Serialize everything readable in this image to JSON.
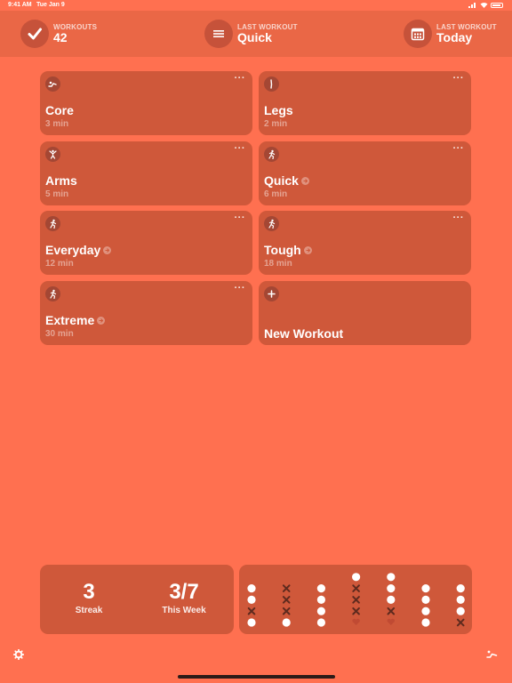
{
  "status_bar": {
    "time": "9:41 AM",
    "date": "Tue Jan 9"
  },
  "header": {
    "workouts": {
      "label": "WORKOUTS",
      "value": "42",
      "icon": "checkmark-icon"
    },
    "last_workout": {
      "label": "LAST WORKOUT",
      "value": "Quick",
      "icon": "list-icon"
    },
    "last_date": {
      "label": "LAST WORKOUT",
      "value": "Today",
      "icon": "calendar-icon"
    }
  },
  "workouts": [
    {
      "name": "Core",
      "duration": "3 min",
      "icon": "situp-icon",
      "pro": false
    },
    {
      "name": "Legs",
      "duration": "2 min",
      "icon": "legs-icon",
      "pro": false
    },
    {
      "name": "Arms",
      "duration": "5 min",
      "icon": "arms-icon",
      "pro": false
    },
    {
      "name": "Quick",
      "duration": "6 min",
      "icon": "runner-icon",
      "pro": true
    },
    {
      "name": "Everyday",
      "duration": "12 min",
      "icon": "runner-icon",
      "pro": true
    },
    {
      "name": "Tough",
      "duration": "18 min",
      "icon": "runner-icon",
      "pro": true
    },
    {
      "name": "Extreme",
      "duration": "30 min",
      "icon": "runner-icon",
      "pro": true
    }
  ],
  "more_label": "···",
  "new_workout": {
    "label": "New Workout",
    "icon": "plus-icon"
  },
  "streak": {
    "value": "3",
    "label": "Streak"
  },
  "this_week": {
    "value": "3/7",
    "label": "This Week"
  },
  "week_columns": [
    [
      "dot",
      "dot",
      "x",
      "dot"
    ],
    [
      "x",
      "x",
      "x",
      "dot"
    ],
    [
      "dot",
      "dot",
      "dot",
      "dot"
    ],
    [
      "dot",
      "x",
      "x",
      "x",
      "heart"
    ],
    [
      "dot",
      "dot",
      "dot",
      "x",
      "heart"
    ],
    [
      "dot",
      "dot",
      "dot",
      "dot"
    ],
    [
      "dot",
      "dot",
      "dot",
      "x"
    ]
  ],
  "colors": {
    "background": "#ff7050",
    "card": "#cf583a",
    "header": "#ea6746"
  }
}
